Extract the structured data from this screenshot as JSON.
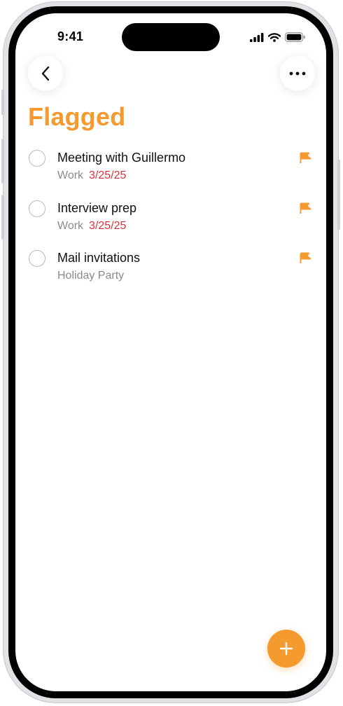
{
  "status_bar": {
    "time": "9:41",
    "icons": [
      "cellular-signal-icon",
      "wifi-icon",
      "battery-icon"
    ]
  },
  "nav": {
    "back_icon": "chevron-left-icon",
    "more_icon": "ellipsis-icon"
  },
  "page": {
    "title": "Flagged"
  },
  "reminders": [
    {
      "title": "Meeting with Guillermo",
      "list": "Work",
      "date": "3/25/25",
      "flagged": true,
      "completed": false
    },
    {
      "title": "Interview prep",
      "list": "Work",
      "date": "3/25/25",
      "flagged": true,
      "completed": false
    },
    {
      "title": "Mail invitations",
      "list": "Holiday Party",
      "date": "",
      "flagged": true,
      "completed": false
    }
  ],
  "fab": {
    "icon": "plus-icon"
  },
  "colors": {
    "accent": "#f59a2f",
    "due_date": "#e0333a",
    "secondary_text": "#8a8a8e"
  }
}
